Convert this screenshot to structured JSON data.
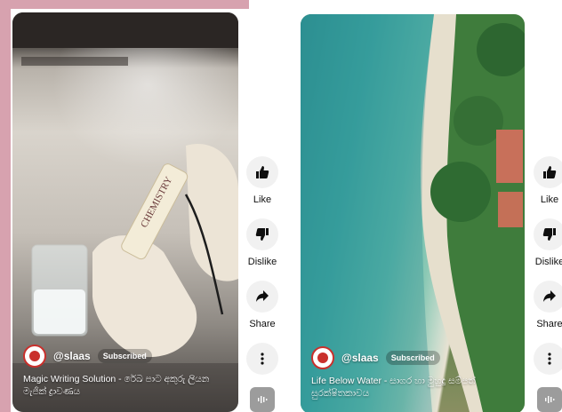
{
  "shorts": [
    {
      "thumbnail": "chemistry-lab-magic-writing",
      "channel": "@slaas",
      "subscribed_label": "Subscribed",
      "title": "Magic Writing Solution - රේඛ පාට අකුරු ලියන මැජික් ද්‍රාවණය"
    },
    {
      "thumbnail": "aerial-coastline-reef",
      "channel": "@slaas",
      "subscribed_label": "Subscribed",
      "title": "Life Below Water - සාගර හා මුහුදු සම්පත් සුරක්ෂිතකාවය"
    }
  ],
  "actions": {
    "like": "Like",
    "dislike": "Dislike",
    "share": "Share"
  },
  "icons": [
    "thumbs-up-icon",
    "thumbs-down-icon",
    "share-arrow-icon",
    "more-vert-icon",
    "sound-wave-icon"
  ],
  "colors": {
    "accent_border": "#d7a2af",
    "action_bg": "#f1f1f1",
    "avatar_ring": "#c9302c"
  }
}
